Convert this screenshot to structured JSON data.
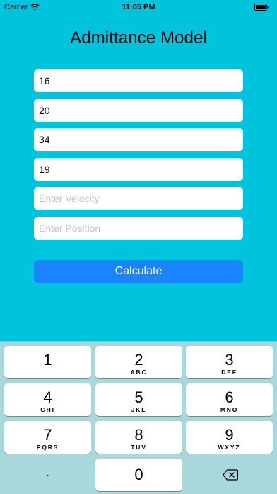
{
  "status_bar": {
    "carrier": "Carrier",
    "time": "11:05 PM",
    "icons": [
      "wifi-icon",
      "battery-icon"
    ]
  },
  "title": "Admittance Model",
  "fields": [
    {
      "value": "16",
      "placeholder": ""
    },
    {
      "value": "20",
      "placeholder": ""
    },
    {
      "value": "34",
      "placeholder": ""
    },
    {
      "value": "19",
      "placeholder": ""
    },
    {
      "value": "",
      "placeholder": "Enter Velocity"
    },
    {
      "value": "",
      "placeholder": "Enter Position"
    }
  ],
  "calculate_label": "Calculate",
  "keypad": {
    "keys": [
      {
        "digit": "1",
        "letters": ""
      },
      {
        "digit": "2",
        "letters": "ABC"
      },
      {
        "digit": "3",
        "letters": "DEF"
      },
      {
        "digit": "4",
        "letters": "GHI"
      },
      {
        "digit": "5",
        "letters": "JKL"
      },
      {
        "digit": "6",
        "letters": "MNO"
      },
      {
        "digit": "7",
        "letters": "PQRS"
      },
      {
        "digit": "8",
        "letters": "TUV"
      },
      {
        "digit": "9",
        "letters": "WXYZ"
      }
    ],
    "decimal": ".",
    "zero": "0",
    "delete_icon": "backspace-icon"
  },
  "colors": {
    "background": "#00C4DD",
    "button": "#1A84FF",
    "keypad_bg": "#A8D7DC"
  }
}
